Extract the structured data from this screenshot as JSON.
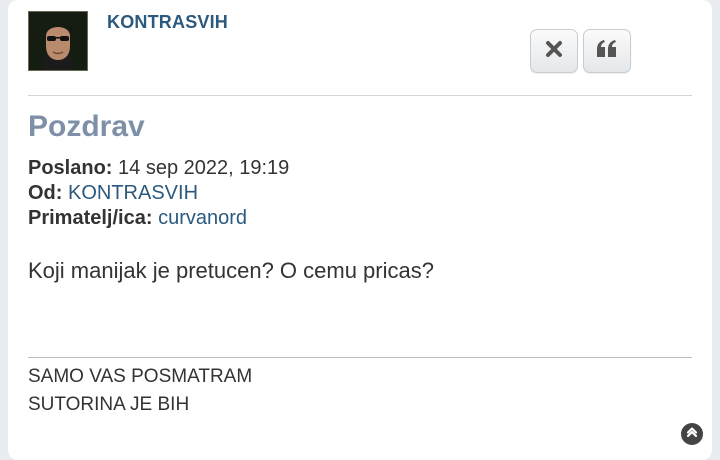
{
  "post": {
    "author": "KONTRASVIH",
    "subject": "Pozdrav",
    "sent_label": "Poslano:",
    "sent_value": "14 sep 2022, 19:19",
    "from_label": "Od:",
    "from_value": "KONTRASVIH",
    "to_label": "Primatelj/ica:",
    "to_value": "curvanord",
    "message": "Koji manijak je pretucen? O cemu pricas?",
    "signature": [
      "SAMO VAS POSMATRAM",
      "SUTORINA JE BIH"
    ]
  },
  "icons": {
    "delete": "close-icon",
    "quote": "quote-icon",
    "top": "chevron-up-icon"
  },
  "colors": {
    "username": "#2b5a7e",
    "subject": "#7e90a8",
    "link": "#2b5a7e",
    "background": "#e9edf1"
  }
}
